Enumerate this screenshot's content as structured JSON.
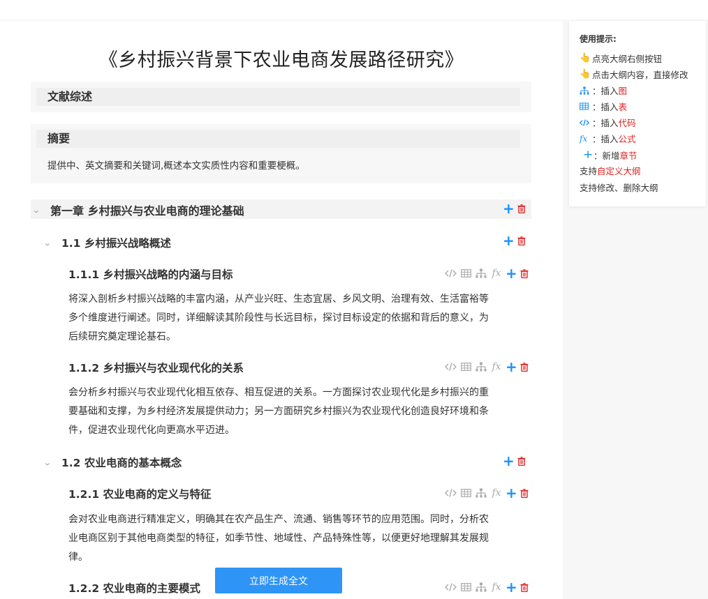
{
  "doc": {
    "title": "《乡村振兴背景下农业电商发展路径研究》"
  },
  "lit_review": {
    "heading": "文献综述"
  },
  "abstract": {
    "heading": "摘要",
    "desc": "提供中、英文摘要和关键词,概述本文实质性内容和重要梗概。"
  },
  "chapter1": {
    "title": "第一章 乡村振兴与农业电商的理论基础",
    "s1": {
      "title": "1.1 乡村振兴战略概述",
      "s11": {
        "title": "1.1.1 乡村振兴战略的内涵与目标",
        "lines": [
          "将深入剖析乡村振兴战略的丰富内涵，从产业兴旺、生态宜居、乡风文明、治理有效、生活富裕等",
          "多个维度进行阐述。同时，详细解读其阶段性与长远目标，探讨目标设定的依据和背后的意义，为",
          "后续研究奠定理论基石。"
        ]
      },
      "s12": {
        "title": "1.1.2 乡村振兴与农业现代化的关系",
        "lines": [
          "会分析乡村振兴与农业现代化相互依存、相互促进的关系。一方面探讨农业现代化是乡村振兴的重",
          "要基础和支撑，为乡村经济发展提供动力；另一方面研究乡村振兴为农业现代化创造良好环境和条",
          "件，促进农业现代化向更高水平迈进。"
        ]
      }
    },
    "s2": {
      "title": "1.2 农业电商的基本概念",
      "s21": {
        "title": "1.2.1 农业电商的定义与特征",
        "lines": [
          "会对农业电商进行精准定义，明确其在农产品生产、流通、销售等环节的应用范围。同时，分析农",
          "业电商区别于其他电商类型的特征，如季节性、地域性、产品特殊性等，以便更好地理解其发展规",
          "律。"
        ]
      },
      "s22": {
        "title": "1.2.2 农业电商的主要模式"
      }
    }
  },
  "generate_button": "立即生成全文",
  "tips": {
    "title": "使用提示:",
    "t1": "点亮大纲右侧按钮",
    "t2": "点击大纲内容，直接修改",
    "t3_pre": "：插入",
    "t3_hl": "图",
    "t4_pre": "：插入",
    "t4_hl": "表",
    "t5_pre": "：插入",
    "t5_hl": "代码",
    "t6_pre": "：插入",
    "t6_hl": "公式",
    "t7_pre": "：新增",
    "t7_hl": "章节",
    "t8_pre": "支持",
    "t8_hl": "自定义大纲",
    "t9": "支持修改、删除大纲"
  },
  "colors": {
    "accent": "#1890ff",
    "danger": "#e02020",
    "button": "#2e94f5"
  },
  "icons": {
    "code": "code-icon",
    "table": "table-icon",
    "chart": "org-chart-icon",
    "formula": "formula-icon",
    "add": "plus-icon",
    "delete": "trash-icon",
    "hand": "pointing-hand-icon",
    "expand": "chevron-down-icon"
  }
}
